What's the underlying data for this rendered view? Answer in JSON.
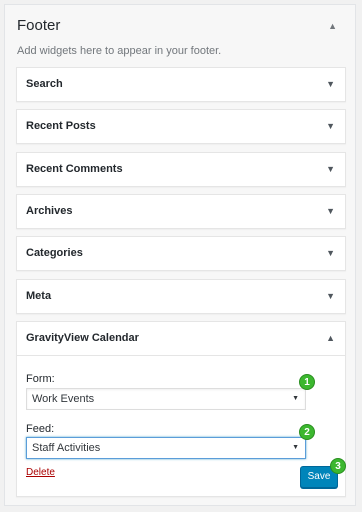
{
  "sidebar": {
    "title": "Footer",
    "toggle": "▲",
    "description": "Add widgets here to appear in your footer."
  },
  "widgets": [
    {
      "title": "Search",
      "arrow": "▼"
    },
    {
      "title": "Recent Posts",
      "arrow": "▼"
    },
    {
      "title": "Recent Comments",
      "arrow": "▼"
    },
    {
      "title": "Archives",
      "arrow": "▼"
    },
    {
      "title": "Categories",
      "arrow": "▼"
    },
    {
      "title": "Meta",
      "arrow": "▼"
    }
  ],
  "calendar_widget": {
    "title": "GravityView Calendar",
    "arrow": "▲",
    "form_label": "Form:",
    "form_value": "Work Events",
    "feed_label": "Feed:",
    "feed_value": "Staff Activities",
    "caret": "▼",
    "delete_label": "Delete",
    "save_label": "Save",
    "badges": [
      "1",
      "2",
      "3"
    ]
  },
  "colors": {
    "badge": "#3cb72f",
    "save_button": "#0085ba",
    "delete_link": "#aa0000",
    "focus_border": "#5b9dd9"
  }
}
